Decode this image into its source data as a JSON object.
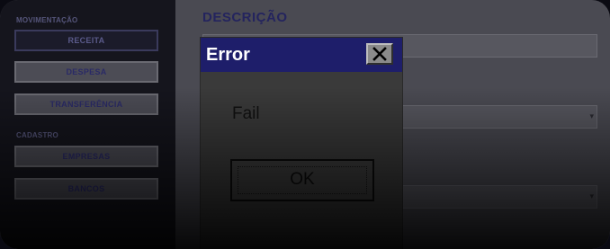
{
  "background_app": {
    "sidebar": {
      "section_header_1": "MOVIMENTAÇÃO",
      "buttons_1": [
        {
          "label": "RECEITA",
          "active": true
        },
        {
          "label": "DESPESA",
          "active": false
        },
        {
          "label": "TRANSFERÊNCIA",
          "active": false
        }
      ],
      "section_header_2": "CADASTRO",
      "buttons_2": [
        {
          "label": "EMPRESAS"
        },
        {
          "label": "BANCOS"
        }
      ]
    },
    "main": {
      "title": "DESCRIÇÃO"
    }
  },
  "dialog": {
    "title": "Error",
    "message": "Fail",
    "ok_label": "OK",
    "close_icon": "close-x-icon",
    "colors": {
      "titlebar": "#1e1e6a",
      "title_text": "#ffffff"
    }
  }
}
